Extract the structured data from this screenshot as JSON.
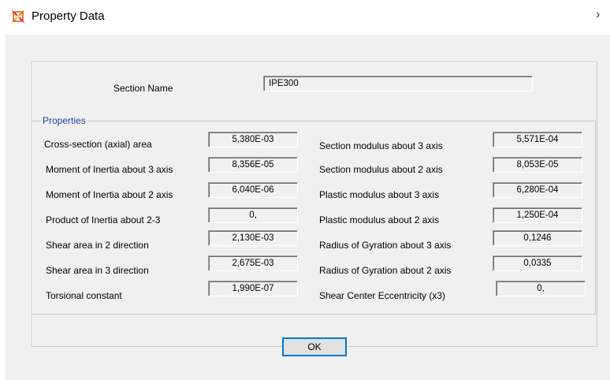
{
  "window": {
    "title": "Property Data",
    "close_glyph": "›",
    "accent": "#0078d7"
  },
  "section": {
    "label": "Section Name",
    "value": "IPE300"
  },
  "properties": {
    "group_title": "Properties",
    "left": [
      {
        "label": "Cross-section (axial) area",
        "value": "5,380E-03"
      },
      {
        "label": "Moment of Inertia about 3 axis",
        "value": "8,356E-05"
      },
      {
        "label": "Moment of Inertia about 2 axis",
        "value": "6,040E-06"
      },
      {
        "label": "Product of Inertia about 2-3",
        "value": "0,"
      },
      {
        "label": "Shear area in 2 direction",
        "value": "2,130E-03"
      },
      {
        "label": "Shear area in 3 direction",
        "value": "2,675E-03"
      },
      {
        "label": "Torsional constant",
        "value": "1,990E-07"
      }
    ],
    "right": [
      {
        "label": "Section modulus about 3 axis",
        "value": "5,571E-04"
      },
      {
        "label": "Section modulus about 2 axis",
        "value": "8,053E-05"
      },
      {
        "label": "Plastic modulus about 3 axis",
        "value": "6,280E-04"
      },
      {
        "label": "Plastic modulus about 2 axis",
        "value": "1,250E-04"
      },
      {
        "label": "Radius of Gyration about 3 axis",
        "value": "0,1246"
      },
      {
        "label": "Radius of Gyration about 2 axis",
        "value": "0,0335"
      },
      {
        "label": "Shear Center Eccentricity (x3)",
        "value": "0,"
      }
    ]
  },
  "buttons": {
    "ok_label": "OK"
  }
}
